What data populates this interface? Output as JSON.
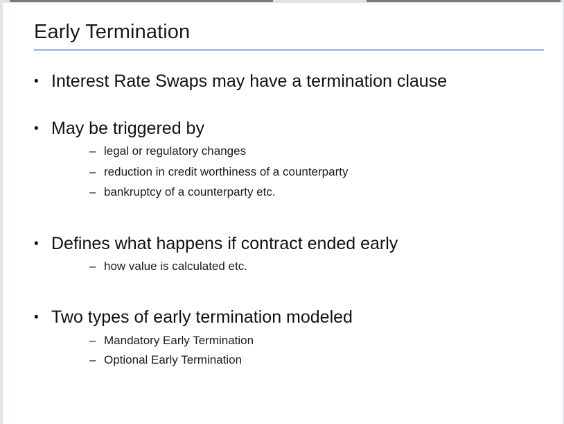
{
  "slide": {
    "title": "Early Termination",
    "bullets": [
      {
        "text": "Interest Rate Swaps may have a termination clause",
        "subs": []
      },
      {
        "text": "May be triggered by",
        "subs": [
          "legal or regulatory changes",
          "reduction in credit worthiness of a counterparty",
          "bankruptcy of a counterparty etc."
        ]
      },
      {
        "text": "Defines what happens if contract ended early",
        "subs": [
          "how value is calculated etc."
        ]
      },
      {
        "text": "Two types of early termination modeled",
        "subs": [
          "Mandatory Early Termination",
          "Optional Early Termination"
        ]
      }
    ],
    "bullet_glyph": "•",
    "sub_glyph": "–"
  },
  "colors": {
    "title_rule": "#86b3ee",
    "text": "#111111",
    "frame": "#e3e6ea"
  }
}
